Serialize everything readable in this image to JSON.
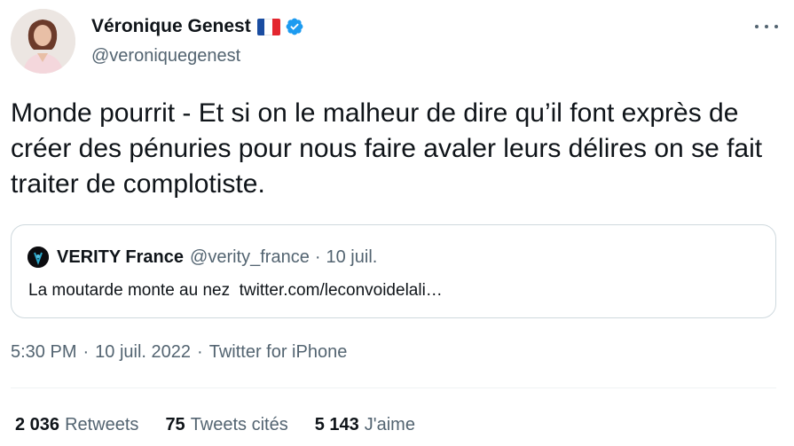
{
  "author": {
    "display_name": "Véronique Genest",
    "handle": "@veroniquegenest",
    "flag_colors": [
      "#1a4da1",
      "#ffffff",
      "#e3262f"
    ],
    "verified_color": "#1d9bf0",
    "avatar_icon": "profile-photo"
  },
  "more_icon": "ellipsis-icon",
  "tweet": {
    "text": "Monde pourrit - Et si on le malheur de dire qu’il font exprès de créer des pénuries pour nous faire avaler leurs délires on se fait traiter de complotiste."
  },
  "quote": {
    "display_name": "VERITY France",
    "handle": "@verity_france",
    "separator": "·",
    "date": "10 juil.",
    "text": "La moutarde monte au nez  twitter.com/leconvoidelali…"
  },
  "meta": {
    "time": "5:30 PM",
    "separator": "·",
    "date": "10 juil. 2022",
    "source": "Twitter for iPhone"
  },
  "stats": [
    {
      "count": "2 036",
      "label": "Retweets"
    },
    {
      "count": "75",
      "label": "Tweets cités"
    },
    {
      "count": "5 143",
      "label": "J'aime"
    }
  ]
}
